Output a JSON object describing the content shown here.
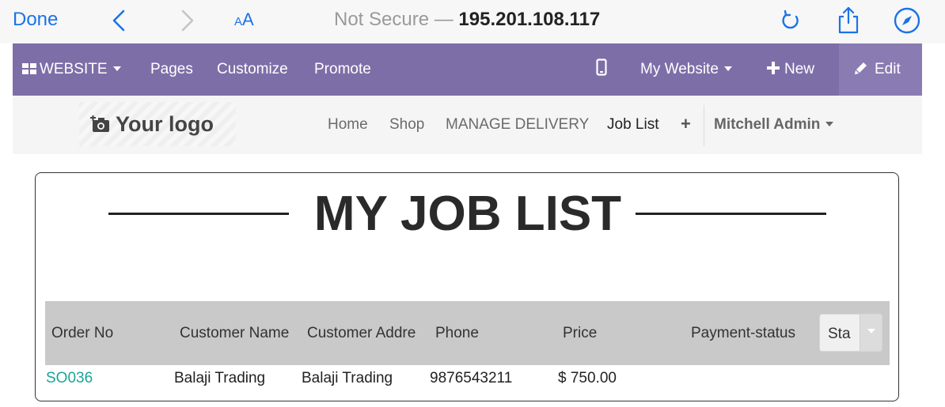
{
  "browser": {
    "done_label": "Done",
    "text_size_small": "A",
    "text_size_big": "A",
    "url_prefix": "Not Secure — ",
    "url_host": "195.201.108.117",
    "icons": [
      "chevron-left-icon",
      "chevron-right-icon",
      "reload-icon",
      "share-icon",
      "compass-icon"
    ]
  },
  "editor_bar": {
    "website_label": "WEBSITE",
    "pages_label": "Pages",
    "customize_label": "Customize",
    "promote_label": "Promote",
    "my_website_label": "My Website",
    "new_label": "New",
    "edit_label": "Edit",
    "background_color": "#7e6ea8"
  },
  "site_header": {
    "logo_text": "Your logo",
    "menu": {
      "home": "Home",
      "shop": "Shop",
      "manage_delivery": "MANAGE DELIVERY",
      "job_list": "Job List",
      "add": "+"
    },
    "user_name": "Mitchell Admin"
  },
  "job_list": {
    "title": "MY JOB LIST",
    "columns": {
      "order_no": "Order No",
      "customer_name": "Customer Name",
      "customer_address": "Customer Addre",
      "phone": "Phone",
      "price": "Price",
      "payment_status": "Payment-status"
    },
    "status_filter_value": "Sta",
    "rows": [
      {
        "order_no": "SO036",
        "customer_name": "Balaji Trading",
        "customer_address": "Balaji Trading",
        "phone": "9876543211",
        "price": "$ 750.00",
        "payment_status": ""
      }
    ],
    "link_color": "#1aa597"
  }
}
